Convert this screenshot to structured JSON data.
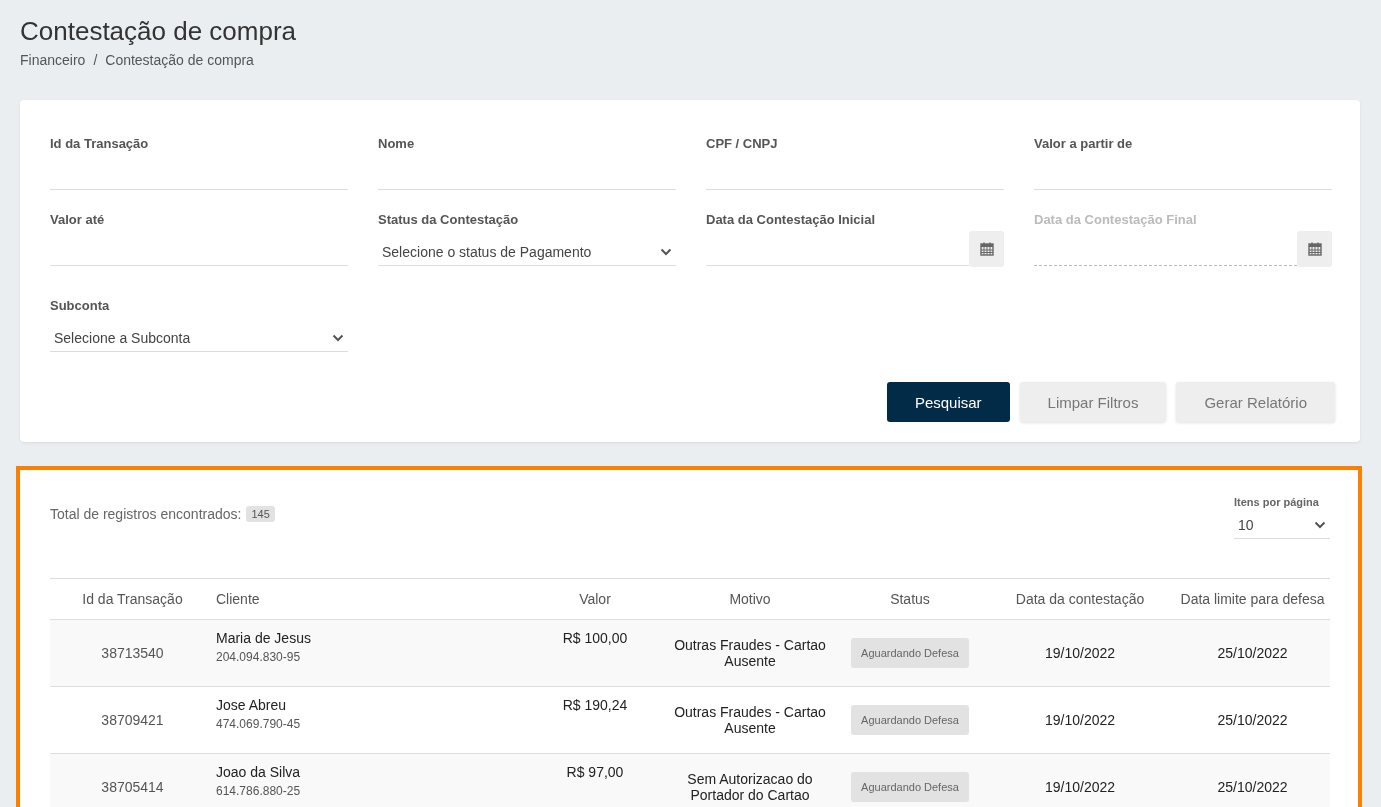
{
  "page": {
    "title": "Contestação de compra",
    "breadcrumb": [
      "Financeiro",
      "Contestação de compra"
    ],
    "breadcrumb_separator": "/"
  },
  "filters": [
    {
      "kind": "text",
      "label": "Id da Transação"
    },
    {
      "kind": "text",
      "label": "Nome"
    },
    {
      "kind": "text",
      "label": "CPF / CNPJ"
    },
    {
      "kind": "text",
      "label": "Valor a partir de"
    },
    {
      "kind": "text",
      "label": "Valor até"
    },
    {
      "kind": "select",
      "label": "Status da Contestação",
      "value": "Selecione o status de Pagamento"
    },
    {
      "kind": "date",
      "label": "Data da Contestação Inicial",
      "disabled": false
    },
    {
      "kind": "date",
      "label": "Data da Contestação Final",
      "disabled": true
    },
    {
      "kind": "select",
      "label": "Subconta",
      "value": "Selecione a Subconta"
    }
  ],
  "buttons": [
    {
      "label": "Pesquisar",
      "kind": "primary"
    },
    {
      "label": "Limpar Filtros",
      "kind": "secondary"
    },
    {
      "label": "Gerar Relatório",
      "kind": "secondary"
    }
  ],
  "results": {
    "total_label": "Total de registros encontrados:",
    "total": "145",
    "per_page_label": "Itens por página",
    "per_page": "10",
    "columns": [
      "Id da Transação",
      "Cliente",
      "Valor",
      "Motivo",
      "Status",
      "Data da contestação",
      "Data limite para defesa"
    ],
    "rows": [
      {
        "id": "38713540",
        "client": "Maria de Jesus",
        "document": "204.094.830-95",
        "value": "R$ 100,00",
        "reason": "Outras Fraudes - Cartao Ausente",
        "status": "Aguardando Defesa",
        "date": "19/10/2022",
        "deadline": "25/10/2022"
      },
      {
        "id": "38709421",
        "client": "Jose Abreu",
        "document": "474.069.790-45",
        "value": "R$ 190,24",
        "reason": "Outras Fraudes - Cartao Ausente",
        "status": "Aguardando Defesa",
        "date": "19/10/2022",
        "deadline": "25/10/2022"
      },
      {
        "id": "38705414",
        "client": "Joao da Silva",
        "document": "614.786.880-25",
        "value": "R$ 97,00",
        "reason": "Sem Autorizacao do Portador do Cartao",
        "status": "Aguardando Defesa",
        "date": "19/10/2022",
        "deadline": "25/10/2022"
      }
    ]
  }
}
